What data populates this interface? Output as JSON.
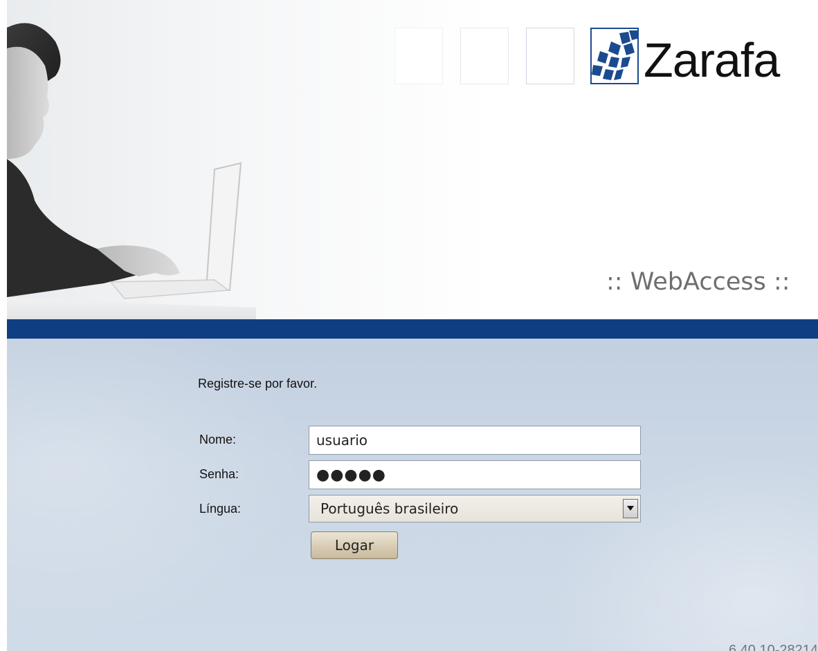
{
  "brand": {
    "logo_text": "Zarafa",
    "product": ":: WebAccess ::",
    "accent_color": "#0f3f82"
  },
  "login": {
    "intro": "Registre-se por favor.",
    "name_label": "Nome:",
    "name_value": "usuario",
    "password_label": "Senha:",
    "password_mask": "●●●●●",
    "language_label": "Língua:",
    "language_value": "Português brasileiro",
    "submit_label": "Logar"
  },
  "footer": {
    "version": "6.40.10-28214"
  }
}
